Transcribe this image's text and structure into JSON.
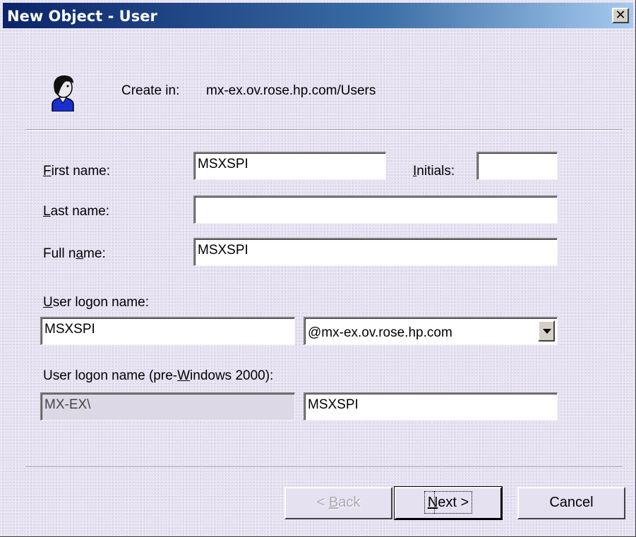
{
  "window": {
    "title": "New Object - User",
    "close_glyph": "✕"
  },
  "header": {
    "icon": "user-icon",
    "create_in_label": "Create in:",
    "create_in_path": "mx-ex.ov.rose.hp.com/Users"
  },
  "form": {
    "first_name": {
      "label_mnemonic": "F",
      "label_rest": "irst name:",
      "value": "MSXSPI"
    },
    "initials": {
      "label_mnemonic": "I",
      "label_rest": "nitials:",
      "value": ""
    },
    "last_name": {
      "label_mnemonic": "L",
      "label_rest": "ast name:",
      "value": ""
    },
    "full_name": {
      "label_pre": "Full n",
      "label_mnemonic": "a",
      "label_rest": "me:",
      "value": "MSXSPI"
    },
    "logon_name": {
      "label_mnemonic": "U",
      "label_rest": "ser logon name:",
      "value": "MSXSPI",
      "domain": "@mx-ex.ov.rose.hp.com"
    },
    "logon_pre2000": {
      "label_pre": "User logon name (pre-",
      "label_mnemonic": "W",
      "label_rest": "indows 2000):",
      "domain_prefix": "MX-EX\\",
      "value": "MSXSPI"
    }
  },
  "buttons": {
    "back": {
      "prefix": "< ",
      "mnemonic": "B",
      "rest": "ack"
    },
    "next": {
      "mnemonic": "N",
      "rest": "ext >"
    },
    "cancel": {
      "label": "Cancel"
    }
  }
}
